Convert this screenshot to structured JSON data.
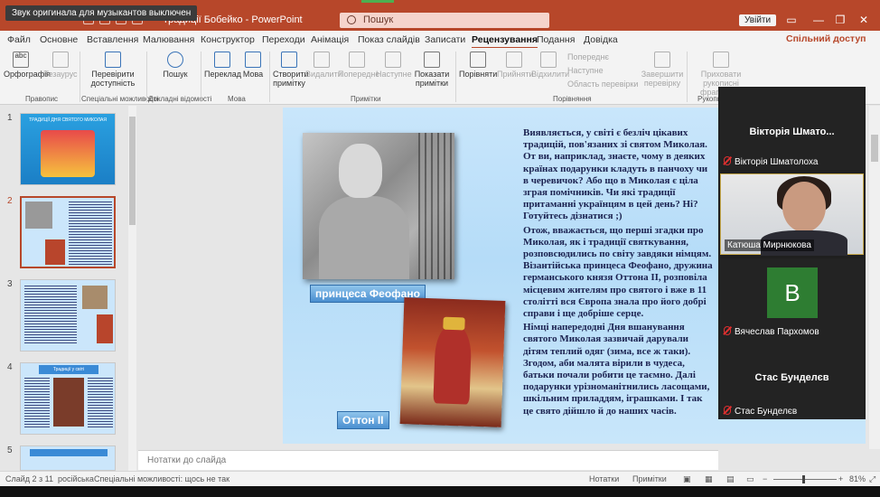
{
  "notification": "Звук оригинала для музыкантов выключен",
  "window": {
    "doc_title": "Традиції Бобейко - PowerPoint",
    "search_placeholder": "Пошук",
    "signin": "Увійти",
    "min": "—",
    "max": "❐",
    "close": "✕"
  },
  "tabs": [
    "Файл",
    "Основне",
    "Вставлення",
    "Малювання",
    "Конструктор",
    "Переходи",
    "Анімація",
    "Показ слайдів",
    "Записати",
    "Рецензування",
    "Подання",
    "Довідка"
  ],
  "active_tab": "Рецензування",
  "share": "Спільний доступ",
  "ribbon": {
    "spelling": "Орфографія",
    "thesaurus": "Тезаурус",
    "accessibility": "Перевірити доступність",
    "lookup": "Пошук",
    "translate": "Переклад",
    "language": "Мова",
    "new_comment": "Створити примітку",
    "delete": "Видалити",
    "previous": "Попереднє",
    "next": "Наступне",
    "show_comments": "Показати примітки",
    "compare": "Порівняти",
    "accept": "Прийняти",
    "reject": "Відхилити",
    "prev_change": "Попереднє",
    "next_change": "Наступне",
    "reviewing_pane": "Область перевірки",
    "end_review": "Завершити перевірку",
    "hide_ink": "Приховати рукописні фрагменти",
    "groups": {
      "proofing": "Правопис",
      "accessibility": "Спеціальні можливості",
      "insights": "Докладні відомості",
      "language": "Мова",
      "comments": "Примітки",
      "compare": "Порівняння",
      "ink": "Рукопис"
    }
  },
  "slides": [
    {
      "num": "1",
      "title": "ТРАДИЦІЇ ДНЯ СВЯТОГО МИКОЛАЯ"
    },
    {
      "num": "2",
      "title": ""
    },
    {
      "num": "3",
      "title": ""
    },
    {
      "num": "4",
      "title": "Традиції у світі"
    },
    {
      "num": "5",
      "title": ""
    }
  ],
  "slide": {
    "caption1": "принцеса Феофано",
    "caption2": "Оттон ІІ",
    "paragraphs": [
      "Виявляється, у світі є безліч цікавих традицій, пов'язаних зі святом Миколая. От ви, наприклад, знаєте, чому в деяких країнах подарунки кладуть в панчоху чи в черевичок? Або що в Миколая є ціла зграя помічників. Чи які традиції притаманні українцям в цей день? Ні? Готуйтесь дізнатися ;)",
      "Отож, вважається, що перші згадки про Миколая, як і традиції святкування, розповсюдились по світу завдяки німцям. Візантійська принцеса Феофано, дружина германського князя Оттона ІІ, розповіла місцевим жителям про святого і вже в 11 столітті вся Європа знала про його добрі справи і ще добріше серце.",
      "Німці напередодні Дня вшанування святого Миколая зазвичай дарували дітям теплий одяг (зима, все ж таки). Згодом, аби малята вірили в чудеса, батьки почали робити це таємно. Далі подарунки урізноманітнились ласощами, шкільним приладдям, іграшками. І так це свято дійшло й до наших часів."
    ]
  },
  "notes_placeholder": "Нотатки до слайда",
  "participants": [
    {
      "big_name": "Вікторія Шмато...",
      "name": "Вікторія Шматолоха",
      "muted": true
    },
    {
      "name": "Катюша Мирнюкова",
      "video": true
    },
    {
      "initial": "В",
      "name": "Вячеслав Пархомов",
      "muted": true,
      "avatar_color": "#2e7d32"
    },
    {
      "big_name": "Стас Бунделєв",
      "name": "Стас Бунделєв",
      "muted": true
    }
  ],
  "status": {
    "slide_info": "Слайд 2 з 11",
    "language": "російська",
    "accessibility": "Спеціальні можливості: щось не так",
    "notes": "Нотатки",
    "comments": "Примітки",
    "zoom": "81%"
  },
  "colors": {
    "accent": "#b7472a",
    "slide_bg": "#c3e3fa",
    "text_dark": "#1b2250"
  }
}
